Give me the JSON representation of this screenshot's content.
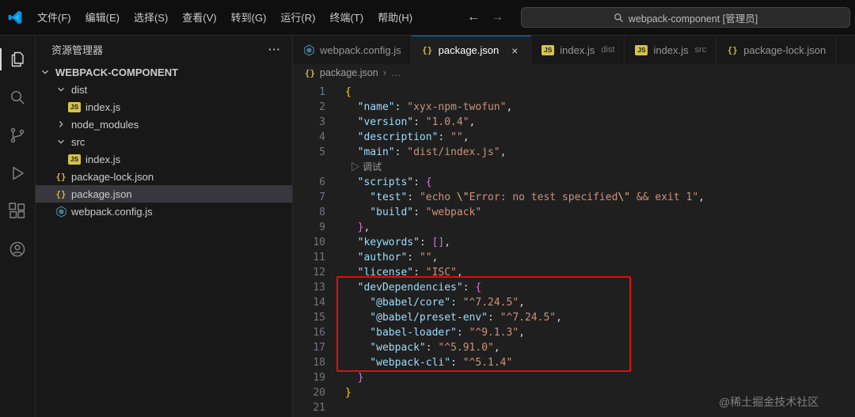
{
  "title_bar": {
    "menus": [
      "文件(F)",
      "编辑(E)",
      "选择(S)",
      "查看(V)",
      "转到(G)",
      "运行(R)",
      "终端(T)",
      "帮助(H)"
    ],
    "back_arrow": "←",
    "forward_arrow": "→",
    "search_text": "webpack-component [管理员]"
  },
  "activity_bar": [
    {
      "icon": "files-icon",
      "active": true
    },
    {
      "icon": "search-icon",
      "active": false
    },
    {
      "icon": "source-control-icon",
      "active": false
    },
    {
      "icon": "run-debug-icon",
      "active": false
    },
    {
      "icon": "extensions-icon",
      "active": false
    },
    {
      "icon": "account-icon",
      "active": false
    }
  ],
  "sidebar": {
    "title": "资源管理器",
    "actions": "···",
    "root": {
      "label": "WEBPACK-COMPONENT",
      "expanded": true
    },
    "tree": [
      {
        "label": "dist",
        "kind": "folder",
        "state": "expanded",
        "depth": 1,
        "selected": false
      },
      {
        "label": "index.js",
        "kind": "js",
        "depth": 2,
        "selected": false
      },
      {
        "label": "node_modules",
        "kind": "folder",
        "state": "collapsed",
        "depth": 1,
        "selected": false
      },
      {
        "label": "src",
        "kind": "folder",
        "state": "expanded",
        "depth": 1,
        "selected": false
      },
      {
        "label": "index.js",
        "kind": "js",
        "depth": 2,
        "selected": false
      },
      {
        "label": "package-lock.json",
        "kind": "json",
        "depth": 1,
        "selected": false
      },
      {
        "label": "package.json",
        "kind": "json",
        "depth": 1,
        "selected": true
      },
      {
        "label": "webpack.config.js",
        "kind": "webpack",
        "depth": 1,
        "selected": false
      }
    ]
  },
  "tabs": [
    {
      "label": "webpack.config.js",
      "icon": "webpack",
      "active": false
    },
    {
      "label": "package.json",
      "icon": "json",
      "active": true,
      "close": "×"
    },
    {
      "label": "index.js",
      "icon": "js",
      "detail": "dist",
      "active": false
    },
    {
      "label": "index.js",
      "icon": "js",
      "detail": "src",
      "active": false
    },
    {
      "label": "package-lock.json",
      "icon": "json",
      "active": false
    }
  ],
  "breadcrumb": {
    "file": "package.json",
    "separator": "›",
    "more": "…"
  },
  "editor": {
    "codelens": {
      "play_icon": "▷",
      "label": "调试"
    },
    "lines": [
      {
        "num": 1,
        "tokens": [
          [
            "b1",
            "{"
          ]
        ]
      },
      {
        "num": 2,
        "tokens": [
          [
            "k",
            "  \"name\""
          ],
          [
            "p",
            ": "
          ],
          [
            "s",
            "\"xyx-npm-twofun\""
          ],
          [
            "p",
            ","
          ]
        ]
      },
      {
        "num": 3,
        "tokens": [
          [
            "k",
            "  \"version\""
          ],
          [
            "p",
            ": "
          ],
          [
            "s",
            "\"1.0.4\""
          ],
          [
            "p",
            ","
          ]
        ]
      },
      {
        "num": 4,
        "tokens": [
          [
            "k",
            "  \"description\""
          ],
          [
            "p",
            ": "
          ],
          [
            "s",
            "\"\""
          ],
          [
            "p",
            ","
          ]
        ]
      },
      {
        "num": 5,
        "tokens": [
          [
            "k",
            "  \"main\""
          ],
          [
            "p",
            ": "
          ],
          [
            "s",
            "\"dist/index.js\""
          ],
          [
            "p",
            ","
          ]
        ]
      },
      {
        "lens": true
      },
      {
        "num": 6,
        "tokens": [
          [
            "k",
            "  \"scripts\""
          ],
          [
            "p",
            ": "
          ],
          [
            "b2",
            "{"
          ]
        ]
      },
      {
        "num": 7,
        "tokens": [
          [
            "k",
            "    \"test\""
          ],
          [
            "p",
            ": "
          ],
          [
            "s",
            "\"echo "
          ],
          [
            "e",
            "\\\""
          ],
          [
            "s",
            "Error: no test specified"
          ],
          [
            "e",
            "\\\""
          ],
          [
            "s",
            " && exit 1\""
          ],
          [
            "p",
            ","
          ]
        ]
      },
      {
        "num": 8,
        "tokens": [
          [
            "k",
            "    \"build\""
          ],
          [
            "p",
            ": "
          ],
          [
            "s",
            "\"webpack\""
          ]
        ]
      },
      {
        "num": 9,
        "tokens": [
          [
            "p",
            "  "
          ],
          [
            "b2",
            "}"
          ],
          [
            "p",
            ","
          ]
        ]
      },
      {
        "num": 10,
        "tokens": [
          [
            "k",
            "  \"keywords\""
          ],
          [
            "p",
            ": "
          ],
          [
            "b2",
            "[]"
          ],
          [
            "p",
            ","
          ]
        ]
      },
      {
        "num": 11,
        "tokens": [
          [
            "k",
            "  \"author\""
          ],
          [
            "p",
            ": "
          ],
          [
            "s",
            "\"\""
          ],
          [
            "p",
            ","
          ]
        ]
      },
      {
        "num": 12,
        "tokens": [
          [
            "k",
            "  \"license\""
          ],
          [
            "p",
            ": "
          ],
          [
            "s",
            "\"ISC\""
          ],
          [
            "p",
            ","
          ]
        ]
      },
      {
        "num": 13,
        "tokens": [
          [
            "k",
            "  \"devDependencies\""
          ],
          [
            "p",
            ": "
          ],
          [
            "b2",
            "{"
          ]
        ]
      },
      {
        "num": 14,
        "tokens": [
          [
            "k",
            "    \"@babel/core\""
          ],
          [
            "p",
            ": "
          ],
          [
            "s",
            "\"^7.24.5\""
          ],
          [
            "p",
            ","
          ]
        ]
      },
      {
        "num": 15,
        "tokens": [
          [
            "k",
            "    \"@babel/preset-env\""
          ],
          [
            "p",
            ": "
          ],
          [
            "s",
            "\"^7.24.5\""
          ],
          [
            "p",
            ","
          ]
        ]
      },
      {
        "num": 16,
        "tokens": [
          [
            "k",
            "    \"babel-loader\""
          ],
          [
            "p",
            ": "
          ],
          [
            "s",
            "\"^9.1.3\""
          ],
          [
            "p",
            ","
          ]
        ]
      },
      {
        "num": 17,
        "tokens": [
          [
            "k",
            "    \"webpack\""
          ],
          [
            "p",
            ": "
          ],
          [
            "s",
            "\"^5.91.0\""
          ],
          [
            "p",
            ","
          ]
        ]
      },
      {
        "num": 18,
        "tokens": [
          [
            "k",
            "    \"webpack-cli\""
          ],
          [
            "p",
            ": "
          ],
          [
            "s",
            "\"^5.1.4\""
          ]
        ]
      },
      {
        "num": 19,
        "tokens": [
          [
            "p",
            "  "
          ],
          [
            "b2",
            "}"
          ]
        ]
      },
      {
        "num": 20,
        "tokens": [
          [
            "b1",
            "}"
          ]
        ]
      },
      {
        "num": 21,
        "tokens": []
      }
    ]
  },
  "annotation": {
    "shape": "rectangle",
    "color": "#e10c0c"
  },
  "watermark": "@稀土掘金技术社区"
}
